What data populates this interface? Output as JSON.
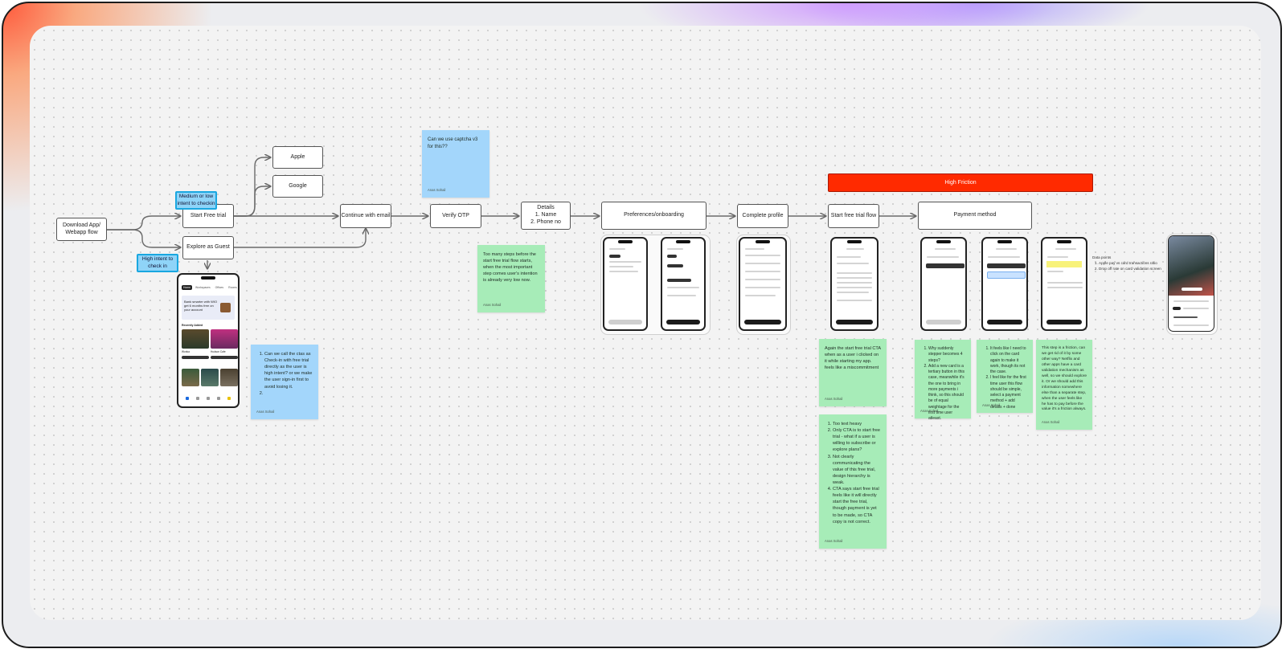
{
  "flow": {
    "download": "Download App/ Webapp flow",
    "start_trial": "Start Free trial",
    "explore_guest": "Explore as Guest",
    "apple": "Apple",
    "google": "Google",
    "continue_email": "Continue with email",
    "verify_otp": "Verify OTP",
    "details_title": "Details",
    "details_items": [
      "1. Name",
      "2. Phone no"
    ],
    "preferences": "Preferences/onboarding",
    "complete_profile": "Complete profile",
    "start_trial_flow": "Start free trial flow",
    "payment_method": "Payment method"
  },
  "tags": {
    "medium_low": "Medium or low intent to checkin",
    "high_intent": "High intent to check in"
  },
  "banner": {
    "high_friction": "High Friction"
  },
  "stickies": {
    "captcha": {
      "text": "Can we use captcha v3 for this??",
      "author": "Anas Sohail"
    },
    "too_many_steps": {
      "text": "Too many steps before the start free trial flow starts, when the most important step comes user's intention is already very low now.",
      "author": "Anas Sohail"
    },
    "ctas": {
      "items": [
        "Can we call the ctas as Check-in with free trial directly as the user is high intent? or we make the user sign-in first to avoid losing it.",
        ""
      ],
      "author": "Anas Sohail"
    },
    "again_trial": {
      "text": "Again the start free trial CTA when as a user i clicked on it while starting my app. feels like a miscommitment",
      "author": "Anas Sohail"
    },
    "text_heavy": {
      "items": [
        "Too text heavy",
        "Only CTA is to start free trial - what if a user is willing to subscribe or explore plans?",
        "Not clearly communicating the value of this free trial, design hierarchy is weak.",
        "CTA says start free trial feels like it will directly start the free trial, though payment is yet to be made, so CTA copy is not correct."
      ],
      "author": "Anas Sohail"
    },
    "stepper": {
      "items": [
        "Why suddenly stepper becomes 4 steps?",
        "Add a new card is a tertiary button in this case, meanwhile it's the one to bring in more payments i think, so this should be of equal weightage for the first time user atleast."
      ],
      "author": "Anas Sohail"
    },
    "card_again": {
      "items": [
        "It feels like I need to click on the card again to make it work, though its not the case.",
        "I feel like for the first time user this flow should be simple, select a payment method + add details + done"
      ],
      "author": "Anas Sohail"
    },
    "friction_step": {
      "text": "This step is a friction, can we get rid of it by some other way? Netflix and other apps have a card validation mechanism as well, so we should explore it. Or we should add this information somewhere else than a separate step, when the user feels like he has to pay before the value it's a friction always.",
      "author": "Anas Sohail"
    }
  },
  "data_points": {
    "title": "Data points",
    "items": [
      "Apple pay vs card transactions ratio",
      "Drop off rate on card validation screen"
    ]
  },
  "guest_phone": {
    "tabs": [
      "Home",
      "Workspaces",
      "Offices",
      "Rooms"
    ],
    "promo": "Bank smarter with WIO get 6 months free on your account",
    "section": "Recently Added",
    "card_a": "Wonka",
    "card_b": "Hudson Cafe"
  },
  "colors": {
    "sticky_green": "#a7ecb8",
    "sticky_blue": "#a3d6fb",
    "tag_blue": "#8fd4f8",
    "friction_red": "#ff2a00"
  }
}
